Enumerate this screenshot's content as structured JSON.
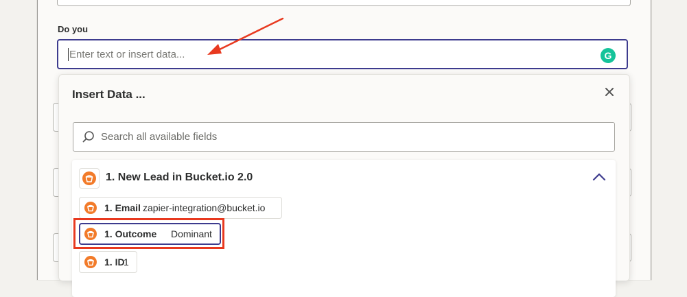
{
  "form": {
    "field_label": "Do you",
    "input_placeholder": "Enter text or insert data..."
  },
  "grammarly": {
    "icon": "grammarly-icon",
    "letter": "G",
    "color": "#15c39a"
  },
  "insert_data": {
    "title": "Insert Data ...",
    "close_icon": "close-icon",
    "search_placeholder": "Search all available fields",
    "group": {
      "title": "1. New Lead in Bucket.io 2.0",
      "app_icon": "bucket-io-icon",
      "expanded": true,
      "fields": [
        {
          "label": "1. Email",
          "value": "zapier-integration@bucket.io",
          "selected": false
        },
        {
          "label": "1. Outcome",
          "value": "Dominant",
          "selected": true
        },
        {
          "label": "1. ID",
          "value": "1",
          "selected": false
        }
      ]
    }
  },
  "colors": {
    "accent": "#3d3b8e",
    "annotation_red": "#e8391f",
    "app_orange": "#f27b2a"
  }
}
